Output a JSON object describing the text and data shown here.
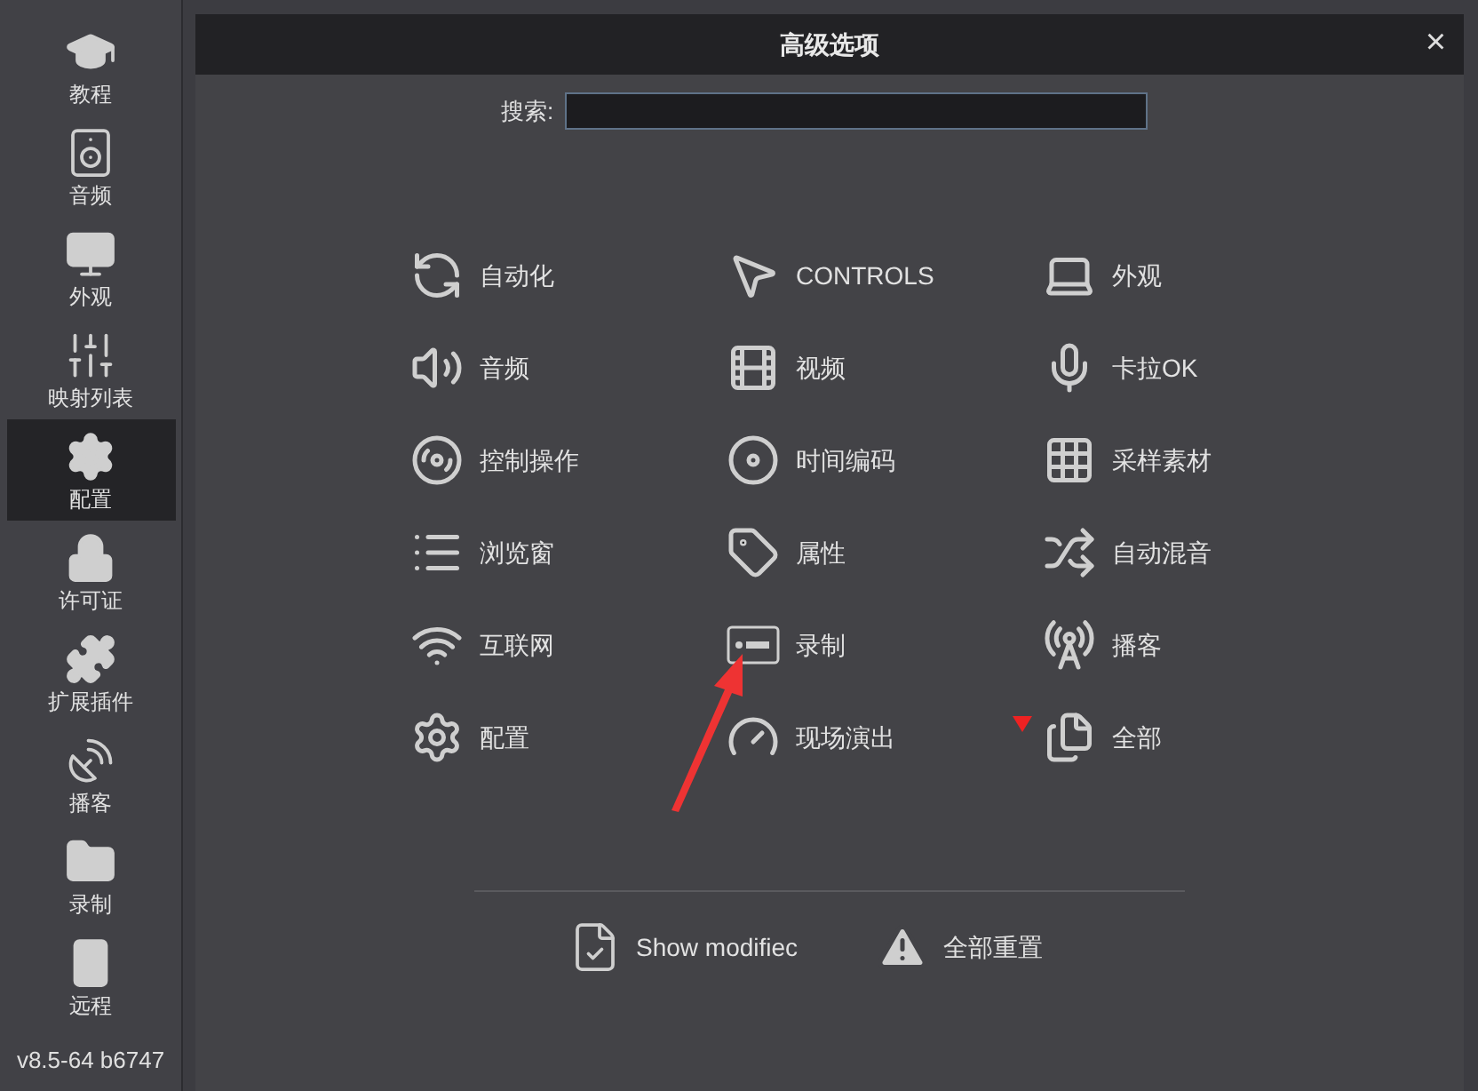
{
  "sidebar": {
    "items": [
      {
        "label": "教程",
        "selected": false
      },
      {
        "label": "音频",
        "selected": false
      },
      {
        "label": "外观",
        "selected": false
      },
      {
        "label": "映射列表",
        "selected": false
      },
      {
        "label": "配置",
        "selected": true
      },
      {
        "label": "许可证",
        "selected": false
      },
      {
        "label": "扩展插件",
        "selected": false
      },
      {
        "label": "播客",
        "selected": false
      },
      {
        "label": "录制",
        "selected": false
      },
      {
        "label": "远程",
        "selected": false
      }
    ],
    "version": "v8.5-64 b6747"
  },
  "dialog": {
    "title": "高级选项",
    "close": "×",
    "search": {
      "label": "搜索:"
    },
    "options": [
      {
        "label": "自动化"
      },
      {
        "label": "CONTROLS"
      },
      {
        "label": "外观"
      },
      {
        "label": "音频"
      },
      {
        "label": "视频"
      },
      {
        "label": "卡拉OK"
      },
      {
        "label": "控制操作"
      },
      {
        "label": "时间编码"
      },
      {
        "label": "采样素材"
      },
      {
        "label": "浏览窗"
      },
      {
        "label": "属性"
      },
      {
        "label": "自动混音"
      },
      {
        "label": "互联网"
      },
      {
        "label": "录制"
      },
      {
        "label": "播客"
      },
      {
        "label": "配置"
      },
      {
        "label": "现场演出"
      },
      {
        "label": "全部"
      }
    ],
    "buttons": [
      {
        "label": "Show modifiec"
      },
      {
        "label": "全部重置"
      }
    ]
  }
}
